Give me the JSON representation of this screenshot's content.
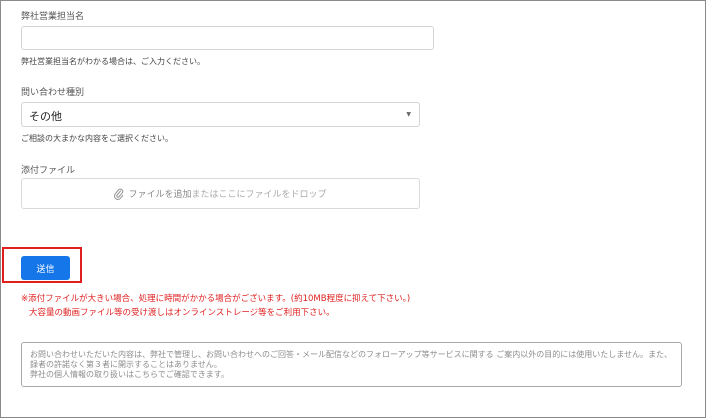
{
  "form": {
    "sales_rep": {
      "label": "弊社営業担当名",
      "value": "",
      "help": "弊社営業担当名がわかる場合は、ご入力ください。"
    },
    "inquiry_type": {
      "label": "問い合わせ種別",
      "value": "その他",
      "help": "ご相談の大まかな内容をご選択ください。"
    },
    "attachment": {
      "label": "添付ファイル",
      "dropzone_main": "ファイルを追加",
      "dropzone_sub": "またはここにファイルをドロップ"
    },
    "submit_label": "送信",
    "notes": [
      "※添付ファイルが大きい場合、処理に時間がかかる場合がございます。(約10MB程度に抑えて下さい。)",
      "大容量の動画ファイル等の受け渡しはオンラインストレージ等をご利用下さい。"
    ],
    "privacy_lines": [
      "お問い合わせいただいた内容は、弊社で管理し、お問い合わせへのご回答・メール配信などのフォローアップ等サービスに関する ご案内以外の目的には使用いたしません。また、ご登",
      "録者の許諾なく第３者に開示することはありません。",
      "弊社の個人情報の取り扱いはこちらでご確認できます。"
    ]
  },
  "colors": {
    "submit": "#1476e8",
    "highlight": "#e01f1f",
    "note": "#e02020"
  },
  "icons": {
    "attach": "paperclip-icon",
    "select_arrow": "chevron-down-icon"
  }
}
